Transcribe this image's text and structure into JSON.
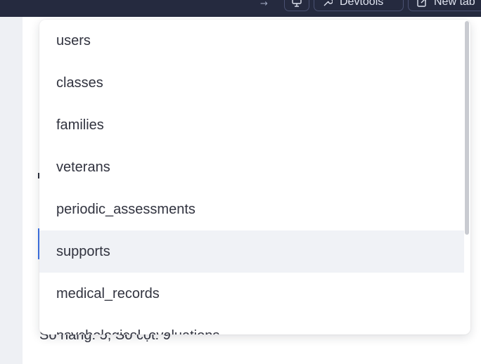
{
  "toolbar": {
    "arrow": "→",
    "devtools_label": "Devtools",
    "newtab_label": "New tab"
  },
  "footer": {
    "status_text": "Số hàng: 5, Số cột: 9"
  },
  "dropdown": {
    "options": [
      "users",
      "classes",
      "families",
      "veterans",
      "periodic_assessments",
      "supports",
      "medical_records",
      "psychological_evaluations"
    ],
    "highlighted": "supports"
  },
  "colors": {
    "topbar": "#252a3f",
    "highlight": "#f0f2f6",
    "accent": "#3f74e8",
    "text": "#31333f"
  }
}
